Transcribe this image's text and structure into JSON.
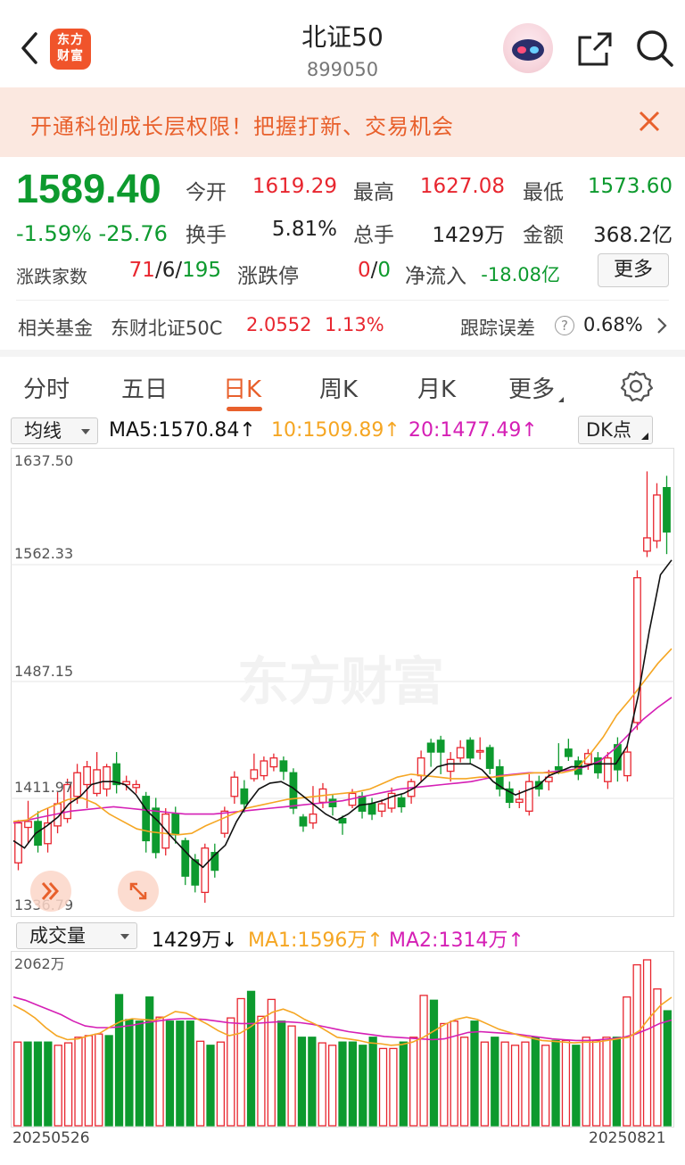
{
  "header": {
    "logo_line1": "东方",
    "logo_line2": "财富",
    "title": "北证50",
    "code": "899050"
  },
  "banner": {
    "text": "开通科创成长层权限！把握打新、交易机会"
  },
  "quote": {
    "price": "1589.40",
    "change_pct": "-1.59%",
    "change_amt": "-25.76",
    "open_label": "今开",
    "open": "1619.29",
    "high_label": "最高",
    "high": "1627.08",
    "low_label": "最低",
    "low": "1573.60",
    "turnover_label": "换手",
    "turnover": "5.81%",
    "volume_label": "总手",
    "volume": "1429万",
    "amount_label": "金额",
    "amount": "368.2亿",
    "breadth_label": "涨跌家数",
    "breadth_up": "71",
    "breadth_slash1": "/",
    "breadth_flat": "6",
    "breadth_slash2": "/",
    "breadth_down": "195",
    "limit_label": "涨跌停",
    "limit_up": "0",
    "limit_slash": "/",
    "limit_down": "0",
    "netflow_label": "净流入",
    "netflow": "-18.08亿",
    "more_label": "更多"
  },
  "fund": {
    "label": "相关基金",
    "name": "东财北证50C",
    "nav": "2.0552",
    "pct": "1.13%",
    "tracking_label": "跟踪误差",
    "help_glyph": "?",
    "tracking": "0.68%"
  },
  "tabs": [
    {
      "label": "分时"
    },
    {
      "label": "五日"
    },
    {
      "label": "日K"
    },
    {
      "label": "周K"
    },
    {
      "label": "月K"
    },
    {
      "label": "更多"
    }
  ],
  "indicators": {
    "ma_selector": "均线",
    "ma5": "MA5:1570.84↑",
    "ma10": "10:1509.89↑",
    "ma20": "20:1477.49↑",
    "dk_label": "DK点",
    "vol_selector": "成交量",
    "vol_value": "1429万↓",
    "vol_ma1": "MA1:1596万↑",
    "vol_ma2": "MA2:1314万↑"
  },
  "colors": {
    "up": "#e8262f",
    "down": "#0d9a2e",
    "ma5": "#111111",
    "ma10": "#f5a623",
    "ma20": "#d51fb5",
    "accent": "#e8602c"
  },
  "chart_data": {
    "type": "candlestick",
    "price_axis_labels": [
      "1637.50",
      "1562.33",
      "1487.15",
      "1411.97",
      "1336.79"
    ],
    "price_range": [
      1336.79,
      1637.5
    ],
    "volume_axis_label": "2062万",
    "volume_max": 2062,
    "start_date": "20250526",
    "end_date": "20250821",
    "candles": [
      {
        "o": 1365,
        "c": 1392,
        "h": 1394,
        "l": 1360
      },
      {
        "o": 1389,
        "c": 1393,
        "h": 1407,
        "l": 1378
      },
      {
        "o": 1393,
        "c": 1377,
        "h": 1400,
        "l": 1372
      },
      {
        "o": 1378,
        "c": 1392,
        "h": 1402,
        "l": 1372
      },
      {
        "o": 1390,
        "c": 1405,
        "h": 1413,
        "l": 1385
      },
      {
        "o": 1395,
        "c": 1418,
        "h": 1422,
        "l": 1392
      },
      {
        "o": 1410,
        "c": 1426,
        "h": 1432,
        "l": 1405
      },
      {
        "o": 1418,
        "c": 1430,
        "h": 1434,
        "l": 1402
      },
      {
        "o": 1412,
        "c": 1428,
        "h": 1440,
        "l": 1410
      },
      {
        "o": 1415,
        "c": 1430,
        "h": 1432,
        "l": 1410
      },
      {
        "o": 1432,
        "c": 1418,
        "h": 1440,
        "l": 1412
      },
      {
        "o": 1418,
        "c": 1420,
        "h": 1424,
        "l": 1414
      },
      {
        "o": 1416,
        "c": 1418,
        "h": 1421,
        "l": 1412
      },
      {
        "o": 1410,
        "c": 1380,
        "h": 1413,
        "l": 1372
      },
      {
        "o": 1402,
        "c": 1372,
        "h": 1409,
        "l": 1368
      },
      {
        "o": 1375,
        "c": 1398,
        "h": 1402,
        "l": 1370
      },
      {
        "o": 1398,
        "c": 1384,
        "h": 1403,
        "l": 1378
      },
      {
        "o": 1380,
        "c": 1356,
        "h": 1382,
        "l": 1350
      },
      {
        "o": 1367,
        "c": 1350,
        "h": 1371,
        "l": 1345
      },
      {
        "o": 1345,
        "c": 1375,
        "h": 1378,
        "l": 1338
      },
      {
        "o": 1372,
        "c": 1360,
        "h": 1378,
        "l": 1355
      },
      {
        "o": 1385,
        "c": 1400,
        "h": 1403,
        "l": 1382
      },
      {
        "o": 1410,
        "c": 1423,
        "h": 1427,
        "l": 1405
      },
      {
        "o": 1415,
        "c": 1405,
        "h": 1421,
        "l": 1399
      },
      {
        "o": 1422,
        "c": 1428,
        "h": 1439,
        "l": 1420
      },
      {
        "o": 1424,
        "c": 1434,
        "h": 1437,
        "l": 1421
      },
      {
        "o": 1430,
        "c": 1436,
        "h": 1439,
        "l": 1427
      },
      {
        "o": 1434,
        "c": 1427,
        "h": 1437,
        "l": 1421
      },
      {
        "o": 1426,
        "c": 1402,
        "h": 1429,
        "l": 1398
      },
      {
        "o": 1396,
        "c": 1390,
        "h": 1398,
        "l": 1386
      },
      {
        "o": 1392,
        "c": 1398,
        "h": 1417,
        "l": 1388
      },
      {
        "o": 1406,
        "c": 1415,
        "h": 1419,
        "l": 1402
      },
      {
        "o": 1408,
        "c": 1403,
        "h": 1411,
        "l": 1397
      },
      {
        "o": 1395,
        "c": 1392,
        "h": 1397,
        "l": 1384
      },
      {
        "o": 1404,
        "c": 1412,
        "h": 1415,
        "l": 1402
      },
      {
        "o": 1410,
        "c": 1400,
        "h": 1413,
        "l": 1395
      },
      {
        "o": 1405,
        "c": 1398,
        "h": 1409,
        "l": 1394
      },
      {
        "o": 1400,
        "c": 1405,
        "h": 1408,
        "l": 1396
      },
      {
        "o": 1402,
        "c": 1412,
        "h": 1416,
        "l": 1399
      },
      {
        "o": 1409,
        "c": 1403,
        "h": 1412,
        "l": 1399
      },
      {
        "o": 1410,
        "c": 1420,
        "h": 1422,
        "l": 1405
      },
      {
        "o": 1424,
        "c": 1436,
        "h": 1441,
        "l": 1420
      },
      {
        "o": 1446,
        "c": 1440,
        "h": 1449,
        "l": 1430
      },
      {
        "o": 1448,
        "c": 1440,
        "h": 1451,
        "l": 1425
      },
      {
        "o": 1427,
        "c": 1435,
        "h": 1440,
        "l": 1420
      },
      {
        "o": 1436,
        "c": 1443,
        "h": 1448,
        "l": 1433
      },
      {
        "o": 1448,
        "c": 1436,
        "h": 1450,
        "l": 1432
      },
      {
        "o": 1440,
        "c": 1441,
        "h": 1450,
        "l": 1435
      },
      {
        "o": 1443,
        "c": 1429,
        "h": 1445,
        "l": 1425
      },
      {
        "o": 1430,
        "c": 1415,
        "h": 1435,
        "l": 1410
      },
      {
        "o": 1415,
        "c": 1406,
        "h": 1420,
        "l": 1402
      },
      {
        "o": 1406,
        "c": 1408,
        "h": 1414,
        "l": 1402
      },
      {
        "o": 1400,
        "c": 1420,
        "h": 1425,
        "l": 1397
      },
      {
        "o": 1420,
        "c": 1415,
        "h": 1424,
        "l": 1410
      },
      {
        "o": 1420,
        "c": 1423,
        "h": 1428,
        "l": 1414
      },
      {
        "o": 1430,
        "c": 1428,
        "h": 1446,
        "l": 1425
      },
      {
        "o": 1442,
        "c": 1437,
        "h": 1449,
        "l": 1434
      },
      {
        "o": 1434,
        "c": 1425,
        "h": 1437,
        "l": 1421
      },
      {
        "o": 1432,
        "c": 1439,
        "h": 1442,
        "l": 1428
      },
      {
        "o": 1436,
        "c": 1426,
        "h": 1440,
        "l": 1422
      },
      {
        "o": 1420,
        "c": 1436,
        "h": 1440,
        "l": 1415
      },
      {
        "o": 1445,
        "c": 1428,
        "h": 1450,
        "l": 1420
      },
      {
        "o": 1424,
        "c": 1440,
        "h": 1445,
        "l": 1420
      },
      {
        "o": 1460,
        "c": 1558,
        "h": 1563,
        "l": 1455
      },
      {
        "o": 1576,
        "c": 1585,
        "h": 1630,
        "l": 1572
      },
      {
        "o": 1583,
        "c": 1614,
        "h": 1622,
        "l": 1578
      },
      {
        "o": 1619,
        "c": 1589,
        "h": 1627,
        "l": 1574
      }
    ],
    "ma5_line": [
      1380,
      1375,
      1385,
      1390,
      1396,
      1405,
      1410,
      1418,
      1420,
      1420,
      1418,
      1411,
      1400,
      1393,
      1384,
      1376,
      1368,
      1362,
      1370,
      1377,
      1393,
      1405,
      1415,
      1419,
      1420,
      1416,
      1410,
      1404,
      1398,
      1394,
      1398,
      1404,
      1405,
      1407,
      1410,
      1412,
      1416,
      1423,
      1430,
      1432,
      1432,
      1432,
      1428,
      1420,
      1415,
      1411,
      1414,
      1417,
      1424,
      1427,
      1430,
      1430,
      1432,
      1432,
      1432,
      1444,
      1478,
      1522,
      1560,
      1570
    ],
    "ma10_line": [
      1393,
      1394,
      1400,
      1404,
      1408,
      1409,
      1405,
      1398,
      1393,
      1388,
      1386,
      1385,
      1384,
      1385,
      1390,
      1394,
      1398,
      1402,
      1404,
      1406,
      1408,
      1409,
      1410,
      1411,
      1412,
      1413,
      1415,
      1419,
      1423,
      1425,
      1424,
      1423,
      1422,
      1422,
      1423,
      1423,
      1424,
      1425,
      1426,
      1426,
      1426,
      1428,
      1438,
      1450,
      1465,
      1476,
      1488,
      1500,
      1510
    ],
    "ma20_line": [
      1392,
      1394,
      1396,
      1398,
      1400,
      1401,
      1402,
      1403,
      1402,
      1401,
      1400,
      1399,
      1398,
      1398,
      1398,
      1399,
      1400,
      1401,
      1402,
      1403,
      1404,
      1405,
      1406,
      1407,
      1409,
      1411,
      1413,
      1415,
      1416,
      1417,
      1418,
      1419,
      1420,
      1422,
      1424,
      1425,
      1426,
      1426,
      1427,
      1428,
      1430,
      1434,
      1442,
      1452,
      1462,
      1470,
      1477
    ],
    "volume": [
      {
        "v": 1040,
        "up": true
      },
      {
        "v": 1040,
        "up": false
      },
      {
        "v": 1040,
        "up": false
      },
      {
        "v": 1040,
        "up": false
      },
      {
        "v": 1000,
        "up": true
      },
      {
        "v": 1030,
        "up": true
      },
      {
        "v": 1100,
        "up": true
      },
      {
        "v": 1120,
        "up": true
      },
      {
        "v": 1140,
        "up": true
      },
      {
        "v": 1120,
        "up": false
      },
      {
        "v": 1630,
        "up": false
      },
      {
        "v": 1320,
        "up": false
      },
      {
        "v": 1300,
        "up": false
      },
      {
        "v": 1600,
        "up": false
      },
      {
        "v": 1350,
        "up": true
      },
      {
        "v": 1300,
        "up": false
      },
      {
        "v": 1300,
        "up": false
      },
      {
        "v": 1300,
        "up": false
      },
      {
        "v": 1050,
        "up": true
      },
      {
        "v": 1000,
        "up": false
      },
      {
        "v": 1040,
        "up": true
      },
      {
        "v": 1340,
        "up": true
      },
      {
        "v": 1580,
        "up": true
      },
      {
        "v": 1670,
        "up": false
      },
      {
        "v": 1360,
        "up": true
      },
      {
        "v": 1570,
        "up": true
      },
      {
        "v": 1300,
        "up": false
      },
      {
        "v": 1240,
        "up": true
      },
      {
        "v": 1100,
        "up": false
      },
      {
        "v": 1100,
        "up": false
      },
      {
        "v": 1030,
        "up": true
      },
      {
        "v": 1000,
        "up": true
      },
      {
        "v": 1040,
        "up": false
      },
      {
        "v": 1040,
        "up": false
      },
      {
        "v": 1000,
        "up": false
      },
      {
        "v": 1100,
        "up": false
      },
      {
        "v": 960,
        "up": true
      },
      {
        "v": 960,
        "up": true
      },
      {
        "v": 1040,
        "up": false
      },
      {
        "v": 1100,
        "up": true
      },
      {
        "v": 1620,
        "up": true
      },
      {
        "v": 1560,
        "up": false
      },
      {
        "v": 1270,
        "up": true
      },
      {
        "v": 1300,
        "up": true
      },
      {
        "v": 1100,
        "up": true
      },
      {
        "v": 1300,
        "up": false
      },
      {
        "v": 1040,
        "up": true
      },
      {
        "v": 1100,
        "up": false
      },
      {
        "v": 1040,
        "up": true
      },
      {
        "v": 1000,
        "up": true
      },
      {
        "v": 1040,
        "up": true
      },
      {
        "v": 1100,
        "up": false
      },
      {
        "v": 1000,
        "up": true
      },
      {
        "v": 1060,
        "up": false
      },
      {
        "v": 1060,
        "up": true
      },
      {
        "v": 1000,
        "up": false
      },
      {
        "v": 1100,
        "up": true
      },
      {
        "v": 1060,
        "up": true
      },
      {
        "v": 1100,
        "up": true
      },
      {
        "v": 1100,
        "up": false
      },
      {
        "v": 1600,
        "up": true
      },
      {
        "v": 2000,
        "up": true
      },
      {
        "v": 2062,
        "up": true
      },
      {
        "v": 1700,
        "up": true
      },
      {
        "v": 1429,
        "up": false
      }
    ],
    "vol_ma1_line": [
      1500,
      1430,
      1340,
      1220,
      1120,
      1070,
      1080,
      1120,
      1150,
      1230,
      1300,
      1330,
      1320,
      1310,
      1350,
      1420,
      1400,
      1330,
      1260,
      1180,
      1120,
      1150,
      1230,
      1330,
      1410,
      1450,
      1400,
      1320,
      1260,
      1180,
      1100,
      1080,
      1060,
      1030,
      1020,
      1000,
      1010,
      1040,
      1100,
      1180,
      1260,
      1320,
      1350,
      1320,
      1260,
      1200,
      1160,
      1120,
      1090,
      1060,
      1050,
      1040,
      1030,
      1040,
      1040,
      1060,
      1080,
      1100,
      1180,
      1350,
      1500,
      1596
    ],
    "vol_ma2_line": [
      1600,
      1560,
      1500,
      1440,
      1380,
      1300,
      1240,
      1220,
      1220,
      1230,
      1250,
      1280,
      1300,
      1320,
      1330,
      1330,
      1320,
      1300,
      1280,
      1270,
      1270,
      1280,
      1290,
      1290,
      1280,
      1260,
      1230,
      1200,
      1170,
      1150,
      1130,
      1110,
      1100,
      1090,
      1080,
      1070,
      1080,
      1120,
      1160,
      1170,
      1160,
      1150,
      1140,
      1120,
      1100,
      1080,
      1070,
      1060,
      1060,
      1070,
      1080,
      1100,
      1140,
      1200,
      1270,
      1314
    ]
  }
}
